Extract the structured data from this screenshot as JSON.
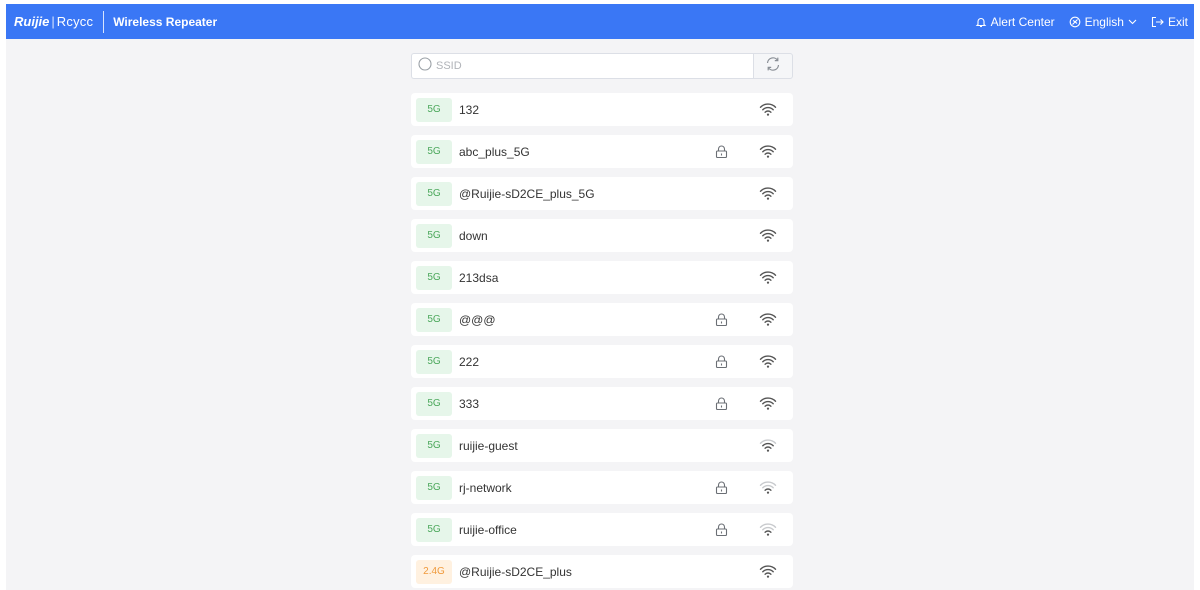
{
  "header": {
    "logo_brand": "Ruijie",
    "logo_separator": "|",
    "logo_sub": "Rcycc",
    "app_title": "Wireless Repeater",
    "alert_label": "Alert Center",
    "language_label": "English",
    "exit_label": "Exit",
    "accent_color": "#3a77f5"
  },
  "search": {
    "placeholder": "SSID",
    "value": "",
    "refresh_icon": "refresh-icon"
  },
  "networks": [
    {
      "band": "5G",
      "ssid": "132",
      "locked": false,
      "signal": 4
    },
    {
      "band": "5G",
      "ssid": "abc_plus_5G",
      "locked": true,
      "signal": 4
    },
    {
      "band": "5G",
      "ssid": "@Ruijie-sD2CE_plus_5G",
      "locked": false,
      "signal": 4
    },
    {
      "band": "5G",
      "ssid": "down",
      "locked": false,
      "signal": 4
    },
    {
      "band": "5G",
      "ssid": "213dsa",
      "locked": false,
      "signal": 4
    },
    {
      "band": "5G",
      "ssid": "@@@",
      "locked": true,
      "signal": 4
    },
    {
      "band": "5G",
      "ssid": "222",
      "locked": true,
      "signal": 4
    },
    {
      "band": "5G",
      "ssid": "333",
      "locked": true,
      "signal": 4
    },
    {
      "band": "5G",
      "ssid": "ruijie-guest",
      "locked": false,
      "signal": 3
    },
    {
      "band": "5G",
      "ssid": "rj-network",
      "locked": true,
      "signal": 2
    },
    {
      "band": "5G",
      "ssid": "ruijie-office",
      "locked": true,
      "signal": 2
    },
    {
      "band": "2.4G",
      "ssid": "@Ruijie-sD2CE_plus",
      "locked": false,
      "signal": 4
    }
  ],
  "colors": {
    "band_5g_bg": "#e6f6ea",
    "band_5g_text": "#4ca85c",
    "band_24g_bg": "#fff1e0",
    "band_24g_text": "#f09a3c"
  }
}
